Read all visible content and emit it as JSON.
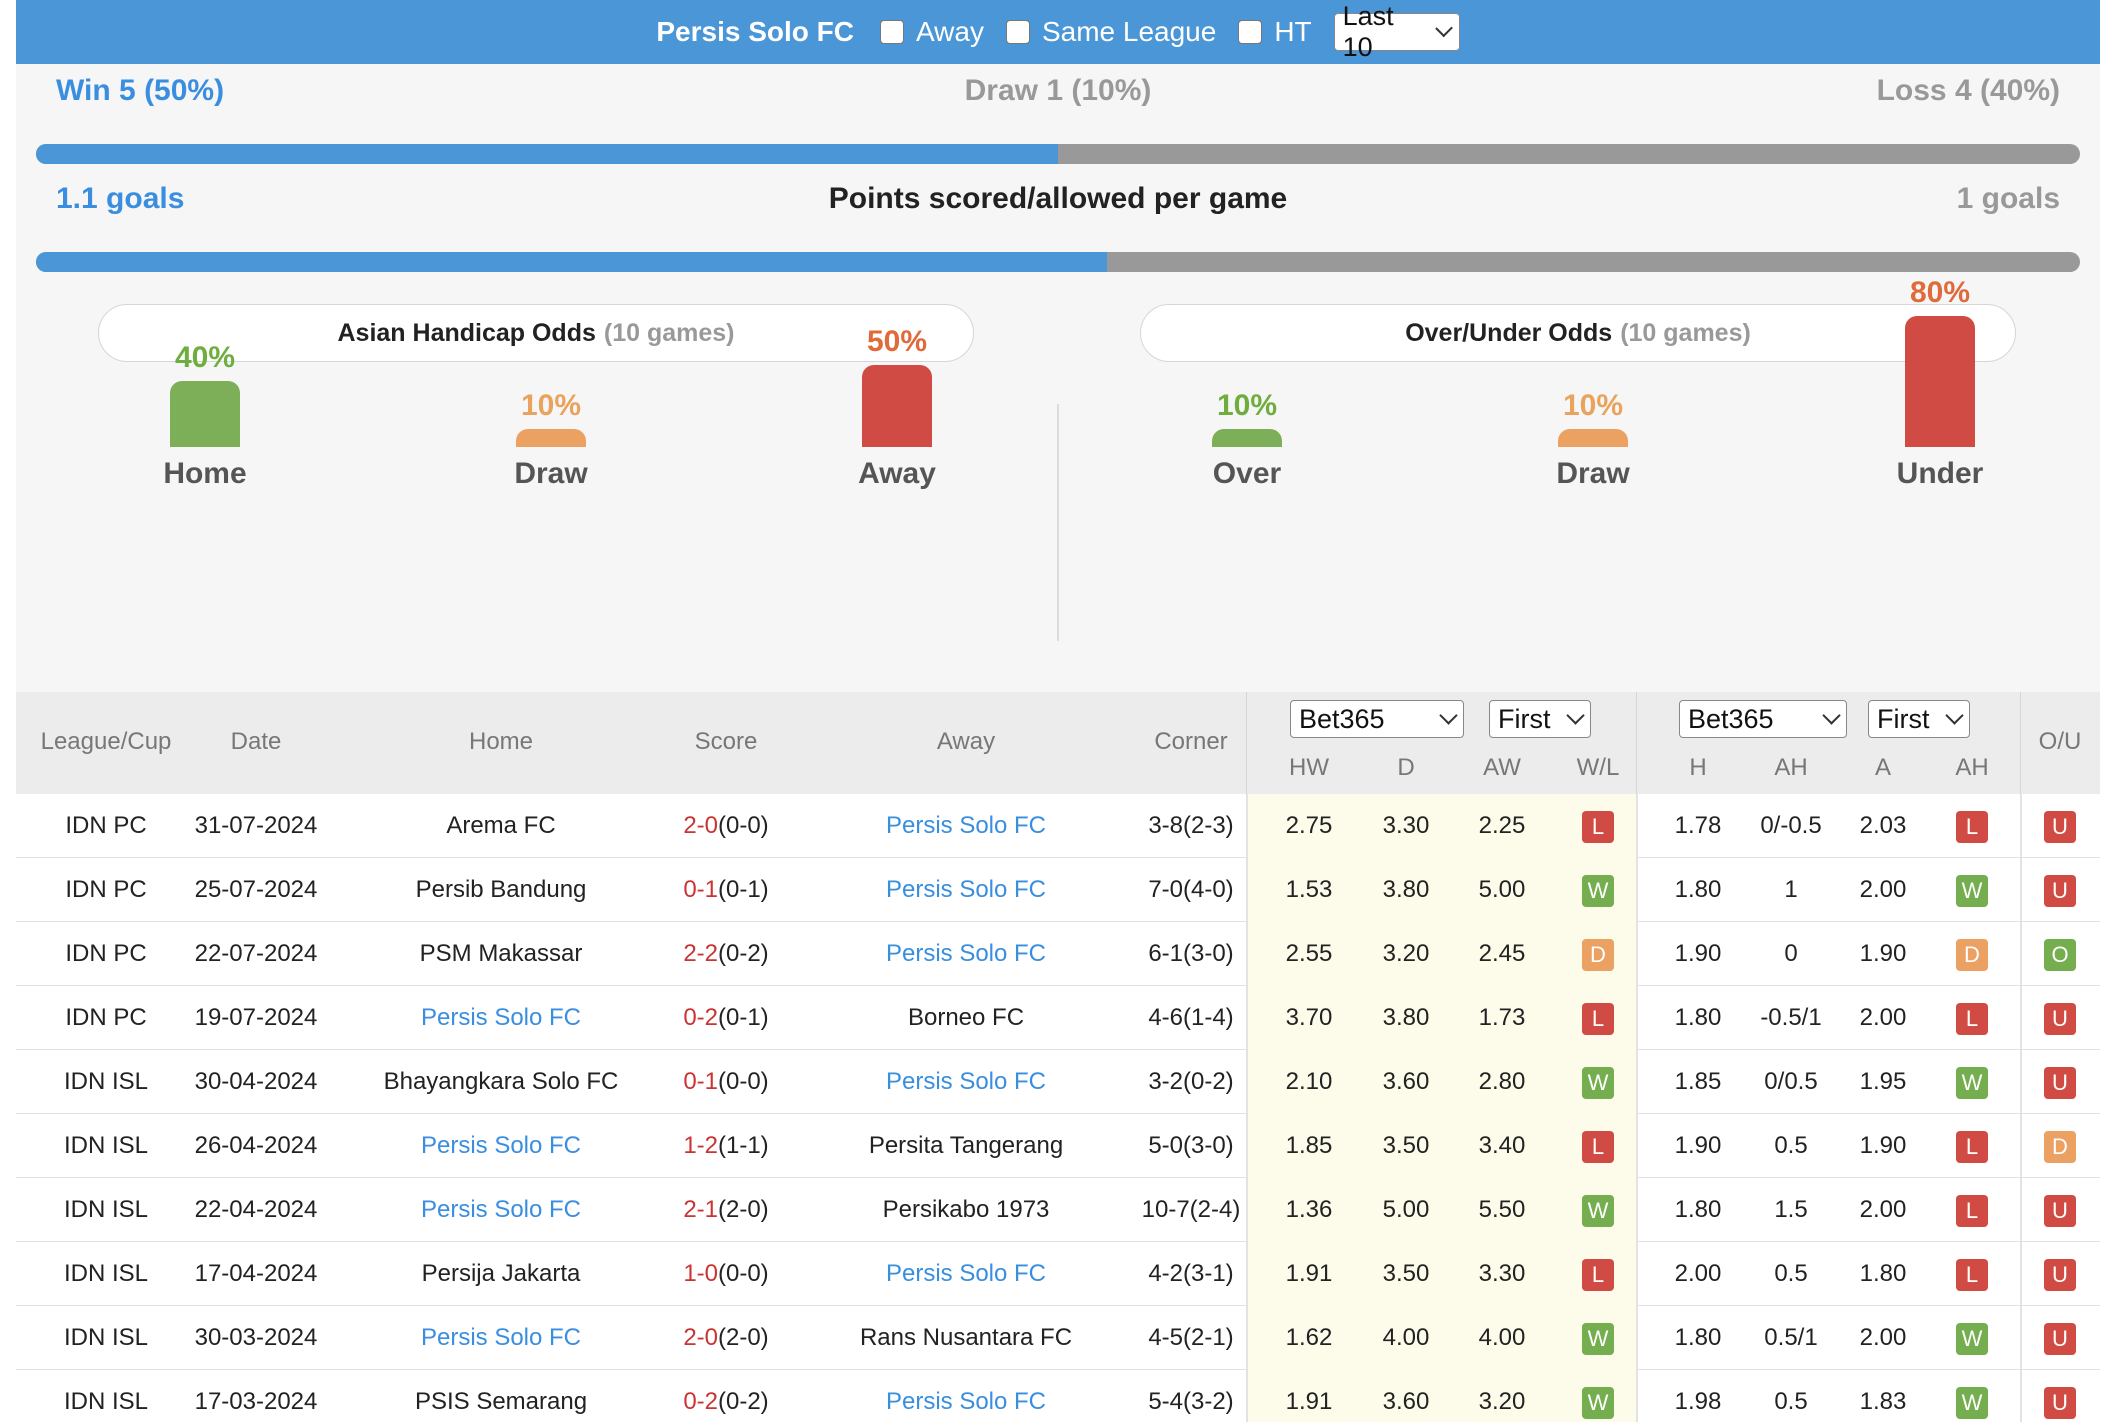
{
  "header": {
    "team": "Persis Solo FC",
    "away_label": "Away",
    "same_league_label": "Same League",
    "ht_label": "HT",
    "range_select": "Last 10"
  },
  "summary": {
    "win_text": "Win 5 (50%)",
    "draw_text": "Draw 1 (10%)",
    "loss_text": "Loss 4 (40%)",
    "win_share": 0.5,
    "goals_scored_text": "1.1 goals",
    "goals_title": "Points scored/allowed per game",
    "goals_allowed_text": "1 goals",
    "goals_share": 0.524
  },
  "ah_panel": {
    "title": "Asian Handicap Odds",
    "count": "(10 games)",
    "bars": [
      {
        "label": "Home",
        "pct_text": "40%",
        "value": 40,
        "color": "#7caf58",
        "text_color": "#6fae3e"
      },
      {
        "label": "Draw",
        "pct_text": "10%",
        "value": 10,
        "color": "#eba162",
        "text_color": "#e9a35c"
      },
      {
        "label": "Away",
        "pct_text": "50%",
        "value": 50,
        "color": "#d14b45",
        "text_color": "#e06a3a"
      }
    ]
  },
  "ou_panel": {
    "title": "Over/Under Odds",
    "count": "(10 games)",
    "bars": [
      {
        "label": "Over",
        "pct_text": "10%",
        "value": 10,
        "color": "#7caf58",
        "text_color": "#6fae3e"
      },
      {
        "label": "Draw",
        "pct_text": "10%",
        "value": 10,
        "color": "#eba162",
        "text_color": "#e9a35c"
      },
      {
        "label": "Under",
        "pct_text": "80%",
        "value": 80,
        "color": "#d14b45",
        "text_color": "#e06a3a"
      }
    ]
  },
  "table": {
    "headers": {
      "league": "League/Cup",
      "date": "Date",
      "home": "Home",
      "score": "Score",
      "away": "Away",
      "corner": "Corner",
      "bookmaker1": "Bet365",
      "period1": "First",
      "bookmaker2": "Bet365",
      "period2": "First",
      "hw": "HW",
      "d": "D",
      "aw": "AW",
      "wl": "W/L",
      "h": "H",
      "ah": "AH",
      "a": "A",
      "ah2": "AH",
      "ou": "O/U"
    },
    "rows": [
      {
        "league": "IDN PC",
        "date": "31-07-2024",
        "home": "Arema FC",
        "home_hl": false,
        "ft": "2-0",
        "ht": "(0-0)",
        "away": "Persis Solo FC",
        "away_hl": true,
        "corner": "3-8(2-3)",
        "hw": "2.75",
        "d": "3.30",
        "aw": "2.25",
        "wl": "L",
        "h": "1.78",
        "ah": "0/-0.5",
        "a": "2.03",
        "ah_res": "L",
        "ou": "U"
      },
      {
        "league": "IDN PC",
        "date": "25-07-2024",
        "home": "Persib Bandung",
        "home_hl": false,
        "ft": "0-1",
        "ht": "(0-1)",
        "away": "Persis Solo FC",
        "away_hl": true,
        "corner": "7-0(4-0)",
        "hw": "1.53",
        "d": "3.80",
        "aw": "5.00",
        "wl": "W",
        "h": "1.80",
        "ah": "1",
        "a": "2.00",
        "ah_res": "W",
        "ou": "U"
      },
      {
        "league": "IDN PC",
        "date": "22-07-2024",
        "home": "PSM Makassar",
        "home_hl": false,
        "ft": "2-2",
        "ht": "(0-2)",
        "away": "Persis Solo FC",
        "away_hl": true,
        "corner": "6-1(3-0)",
        "hw": "2.55",
        "d": "3.20",
        "aw": "2.45",
        "wl": "D",
        "h": "1.90",
        "ah": "0",
        "a": "1.90",
        "ah_res": "D",
        "ou": "O"
      },
      {
        "league": "IDN PC",
        "date": "19-07-2024",
        "home": "Persis Solo FC",
        "home_hl": true,
        "ft": "0-2",
        "ht": "(0-1)",
        "away": "Borneo FC",
        "away_hl": false,
        "corner": "4-6(1-4)",
        "hw": "3.70",
        "d": "3.80",
        "aw": "1.73",
        "wl": "L",
        "h": "1.80",
        "ah": "-0.5/1",
        "a": "2.00",
        "ah_res": "L",
        "ou": "U"
      },
      {
        "league": "IDN ISL",
        "date": "30-04-2024",
        "home": "Bhayangkara Solo FC",
        "home_hl": false,
        "ft": "0-1",
        "ht": "(0-0)",
        "away": "Persis Solo FC",
        "away_hl": true,
        "corner": "3-2(0-2)",
        "hw": "2.10",
        "d": "3.60",
        "aw": "2.80",
        "wl": "W",
        "h": "1.85",
        "ah": "0/0.5",
        "a": "1.95",
        "ah_res": "W",
        "ou": "U"
      },
      {
        "league": "IDN ISL",
        "date": "26-04-2024",
        "home": "Persis Solo FC",
        "home_hl": true,
        "ft": "1-2",
        "ht": "(1-1)",
        "away": "Persita Tangerang",
        "away_hl": false,
        "corner": "5-0(3-0)",
        "hw": "1.85",
        "d": "3.50",
        "aw": "3.40",
        "wl": "L",
        "h": "1.90",
        "ah": "0.5",
        "a": "1.90",
        "ah_res": "L",
        "ou": "D"
      },
      {
        "league": "IDN ISL",
        "date": "22-04-2024",
        "home": "Persis Solo FC",
        "home_hl": true,
        "ft": "2-1",
        "ht": "(2-0)",
        "away": "Persikabo 1973",
        "away_hl": false,
        "corner": "10-7(2-4)",
        "hw": "1.36",
        "d": "5.00",
        "aw": "5.50",
        "wl": "W",
        "h": "1.80",
        "ah": "1.5",
        "a": "2.00",
        "ah_res": "L",
        "ou": "U"
      },
      {
        "league": "IDN ISL",
        "date": "17-04-2024",
        "home": "Persija Jakarta",
        "home_hl": false,
        "ft": "1-0",
        "ht": "(0-0)",
        "away": "Persis Solo FC",
        "away_hl": true,
        "corner": "4-2(3-1)",
        "hw": "1.91",
        "d": "3.50",
        "aw": "3.30",
        "wl": "L",
        "h": "2.00",
        "ah": "0.5",
        "a": "1.80",
        "ah_res": "L",
        "ou": "U"
      },
      {
        "league": "IDN ISL",
        "date": "30-03-2024",
        "home": "Persis Solo FC",
        "home_hl": true,
        "ft": "2-0",
        "ht": "(2-0)",
        "away": "Rans Nusantara FC",
        "away_hl": false,
        "corner": "4-5(2-1)",
        "hw": "1.62",
        "d": "4.00",
        "aw": "4.00",
        "wl": "W",
        "h": "1.80",
        "ah": "0.5/1",
        "a": "2.00",
        "ah_res": "W",
        "ou": "U"
      },
      {
        "league": "IDN ISL",
        "date": "17-03-2024",
        "home": "PSIS Semarang",
        "home_hl": false,
        "ft": "0-2",
        "ht": "(0-2)",
        "away": "Persis Solo FC",
        "away_hl": true,
        "corner": "5-4(3-2)",
        "hw": "1.91",
        "d": "3.60",
        "aw": "3.20",
        "wl": "W",
        "h": "1.98",
        "ah": "0.5",
        "a": "1.83",
        "ah_res": "W",
        "ou": "U"
      }
    ]
  }
}
